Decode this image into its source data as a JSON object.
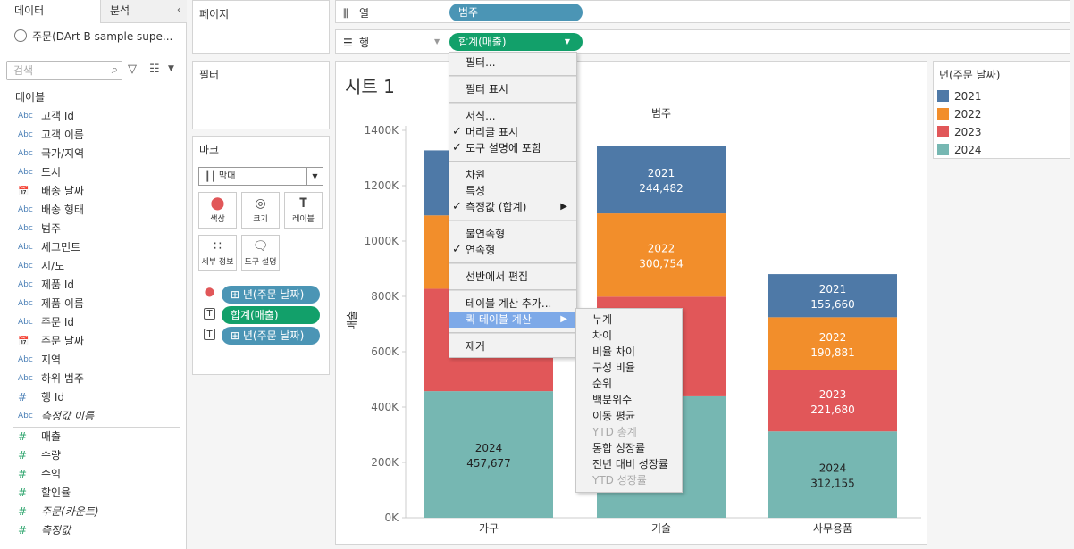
{
  "data_pane": {
    "tab_data": "데이터",
    "tab_analysis": "분석",
    "datasource": "주문(DArt-B sample supe...",
    "search_placeholder": "검색",
    "tables_header": "테이블",
    "fields": [
      {
        "type": "Abc",
        "name": "고객 Id"
      },
      {
        "type": "Abc",
        "name": "고객 이름"
      },
      {
        "type": "Abc",
        "name": "국가/지역"
      },
      {
        "type": "Abc",
        "name": "도시"
      },
      {
        "type": "📅",
        "name": "배송 날짜"
      },
      {
        "type": "Abc",
        "name": "배송 형태"
      },
      {
        "type": "Abc",
        "name": "범주"
      },
      {
        "type": "Abc",
        "name": "세그먼트"
      },
      {
        "type": "Abc",
        "name": "시/도"
      },
      {
        "type": "Abc",
        "name": "제품 Id"
      },
      {
        "type": "Abc",
        "name": "제품 이름"
      },
      {
        "type": "Abc",
        "name": "주문 Id"
      },
      {
        "type": "📅",
        "name": "주문 날짜"
      },
      {
        "type": "Abc",
        "name": "지역"
      },
      {
        "type": "Abc",
        "name": "하위 범주"
      },
      {
        "type": "#",
        "name": "행 Id"
      },
      {
        "type": "Abc",
        "name": "측정값 이름"
      }
    ],
    "measures": [
      {
        "type": "#",
        "name": "매출"
      },
      {
        "type": "#",
        "name": "수량"
      },
      {
        "type": "#",
        "name": "수익"
      },
      {
        "type": "#",
        "name": "할인율"
      },
      {
        "type": "#",
        "name": "주문(카운트)"
      },
      {
        "type": "#",
        "name": "측정값"
      }
    ]
  },
  "pages_card": {
    "title": "페이지"
  },
  "filters_card": {
    "title": "필터"
  },
  "marks_card": {
    "title": "마크",
    "mark_type": "막대",
    "buttons": [
      "색상",
      "크기",
      "레이블",
      "세부 정보",
      "도구 설명"
    ],
    "pills": [
      "년(주문 날짜)",
      "합계(매출)",
      "년(주문 날짜)"
    ]
  },
  "shelves": {
    "columns_label": "열",
    "columns_pill": "범주",
    "rows_label": "행",
    "rows_pill": "합계(매출)"
  },
  "sheet_title": "시트 1",
  "chart_data": {
    "type": "bar",
    "stacked": true,
    "column_header": "범주",
    "categories": [
      "가구",
      "기술",
      "사무용품"
    ],
    "series": [
      {
        "name": "2024",
        "color": "#76b7b2",
        "values": [
          457677,
          439000,
          312155
        ]
      },
      {
        "name": "2023",
        "color": "#e15759",
        "values": [
          370000,
          360000,
          221680
        ]
      },
      {
        "name": "2022",
        "color": "#f28e2b",
        "values": [
          265000,
          300754,
          190881
        ]
      },
      {
        "name": "2021",
        "color": "#4e79a7",
        "values": [
          235000,
          244482,
          155660
        ]
      }
    ],
    "labels": [
      {
        "category": 0,
        "series": 0,
        "year": "2024",
        "value": "457,677"
      },
      {
        "category": 1,
        "series": 3,
        "year": "2021",
        "value": "244,482"
      },
      {
        "category": 1,
        "series": 2,
        "year": "2022",
        "value": "300,754"
      },
      {
        "category": 2,
        "series": 3,
        "year": "2021",
        "value": "155,660"
      },
      {
        "category": 2,
        "series": 2,
        "year": "2022",
        "value": "190,881"
      },
      {
        "category": 2,
        "series": 1,
        "year": "2023",
        "value": "221,680"
      },
      {
        "category": 2,
        "series": 0,
        "year": "2024",
        "value": "312,155"
      }
    ],
    "ylabel": "매출",
    "ylim": [
      0,
      1400000
    ],
    "yticks": [
      "0K",
      "200K",
      "400K",
      "600K",
      "800K",
      "1000K",
      "1200K",
      "1400K"
    ]
  },
  "legend": {
    "title": "년(주문 날짜)",
    "items": [
      {
        "label": "2021",
        "color": "#4e79a7"
      },
      {
        "label": "2022",
        "color": "#f28e2b"
      },
      {
        "label": "2023",
        "color": "#e15759"
      },
      {
        "label": "2024",
        "color": "#76b7b2"
      }
    ]
  },
  "context_menu": {
    "items": [
      {
        "label": "필터...",
        "check": false
      },
      {
        "label": "필터 표시",
        "check": false
      },
      {
        "label": "서식...",
        "check": false
      },
      {
        "label": "머리글 표시",
        "check": true
      },
      {
        "label": "도구 설명에 포함",
        "check": true
      },
      {
        "label": "차원",
        "check": false
      },
      {
        "label": "특성",
        "check": false
      },
      {
        "label": "측정값 (합계)",
        "check": true,
        "submenu": true
      },
      {
        "label": "불연속형",
        "check": false
      },
      {
        "label": "연속형",
        "check": true
      },
      {
        "label": "선반에서 편집",
        "check": false
      },
      {
        "label": "테이블 계산 추가...",
        "check": false
      },
      {
        "label": "퀵 테이블 계산",
        "check": false,
        "submenu": true,
        "highlighted": true
      },
      {
        "label": "제거",
        "check": false
      }
    ],
    "check_glyph": "✓",
    "arrow_glyph": "▶"
  },
  "quick_calc_menu": {
    "items": [
      {
        "label": "누계",
        "disabled": false
      },
      {
        "label": "차이",
        "disabled": false
      },
      {
        "label": "비율 차이",
        "disabled": false
      },
      {
        "label": "구성 비율",
        "disabled": false
      },
      {
        "label": "순위",
        "disabled": false
      },
      {
        "label": "백분위수",
        "disabled": false
      },
      {
        "label": "이동 평균",
        "disabled": false
      },
      {
        "label": "YTD 총계",
        "disabled": true
      },
      {
        "label": "통합 성장률",
        "disabled": false
      },
      {
        "label": "전년 대비 성장률",
        "disabled": false
      },
      {
        "label": "YTD 성장률",
        "disabled": true
      }
    ]
  }
}
